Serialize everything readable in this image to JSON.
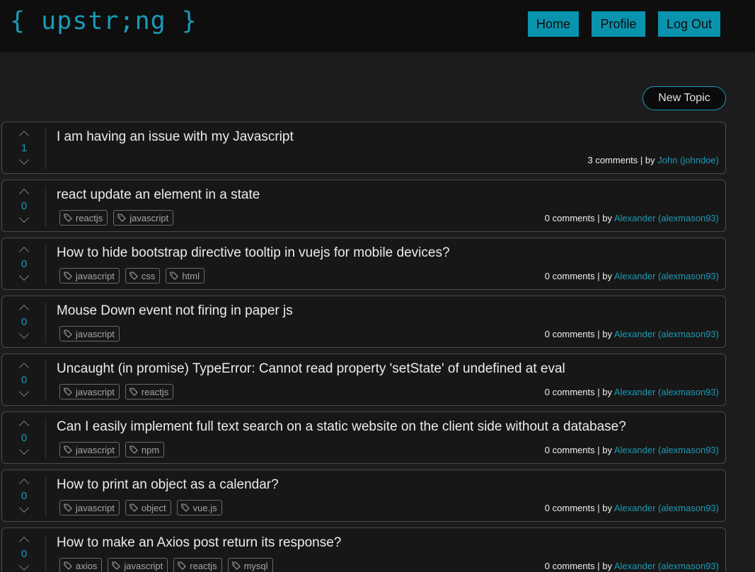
{
  "nav": {
    "brand": "{ upstr;ng }",
    "home_label": "Home",
    "profile_label": "Profile",
    "logout_label": "Log Out"
  },
  "actions": {
    "new_topic_label": "New Topic"
  },
  "colors": {
    "accent": "#1a9bb8",
    "nav_button_bg": "#0a93ad",
    "page_bg": "#1c1c1c",
    "navbar_bg": "#0e0e0e"
  },
  "icons": {
    "vote_up": "chevron-up-icon",
    "vote_down": "chevron-down-icon",
    "tag": "tag-icon"
  },
  "topics": [
    {
      "votes": "1",
      "title": "I am having an issue with my Javascript",
      "tags": [],
      "comments": "3 comments",
      "by": "by",
      "author": "John (johndoe)"
    },
    {
      "votes": "0",
      "title": "react update an element in a state",
      "tags": [
        "reactjs",
        "javascript"
      ],
      "comments": "0 comments",
      "by": "by",
      "author": "Alexander (alexmason93)"
    },
    {
      "votes": "0",
      "title": "How to hide bootstrap directive tooltip in vuejs for mobile devices?",
      "tags": [
        "javascript",
        "css",
        "html"
      ],
      "comments": "0 comments",
      "by": "by",
      "author": "Alexander (alexmason93)"
    },
    {
      "votes": "0",
      "title": "Mouse Down event not firing in paper js",
      "tags": [
        "javascript"
      ],
      "comments": "0 comments",
      "by": "by",
      "author": "Alexander (alexmason93)"
    },
    {
      "votes": "0",
      "title": "Uncaught (in promise) TypeError: Cannot read property 'setState' of undefined at eval",
      "tags": [
        "javascript",
        "reactjs"
      ],
      "comments": "0 comments",
      "by": "by",
      "author": "Alexander (alexmason93)"
    },
    {
      "votes": "0",
      "title": "Can I easily implement full text search on a static website on the client side without a database?",
      "tags": [
        "javascript",
        "npm"
      ],
      "comments": "0 comments",
      "by": "by",
      "author": "Alexander (alexmason93)"
    },
    {
      "votes": "0",
      "title": "How to print an object as a calendar?",
      "tags": [
        "javascript",
        "object",
        "vue.js"
      ],
      "comments": "0 comments",
      "by": "by",
      "author": "Alexander (alexmason93)"
    },
    {
      "votes": "0",
      "title": "How to make an Axios post return its response?",
      "tags": [
        "axios",
        "javascript",
        "reactjs",
        "mysql"
      ],
      "comments": "0 comments",
      "by": "by",
      "author": "Alexander (alexmason93)"
    }
  ]
}
